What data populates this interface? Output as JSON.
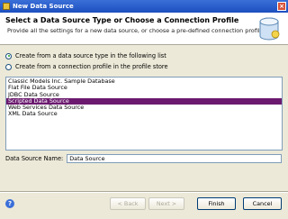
{
  "window": {
    "title": "New Data Source"
  },
  "banner": {
    "heading": "Select a Data Source Type or Choose a Connection Profile",
    "description": "Provide all the settings for a new data source, or choose a pre-defined connection profile"
  },
  "options": [
    {
      "label": "Create from a data source type in the following list",
      "checked": true
    },
    {
      "label": "Create from a connection profile in the profile store",
      "checked": false
    }
  ],
  "data_source_types": [
    "Classic Models Inc. Sample Database",
    "Flat File Data Source",
    "JDBC Data Source",
    "Scripted Data Source",
    "Web Services Data Source",
    "XML Data Source"
  ],
  "selected_index": 3,
  "name_field": {
    "label": "Data Source Name:",
    "value": "Data Source"
  },
  "buttons": {
    "back": "< Back",
    "next": "Next >",
    "finish": "Finish",
    "cancel": "Cancel"
  },
  "colors": {
    "selection": "#6b1a6f",
    "titlebar": "#1d4fbf"
  }
}
